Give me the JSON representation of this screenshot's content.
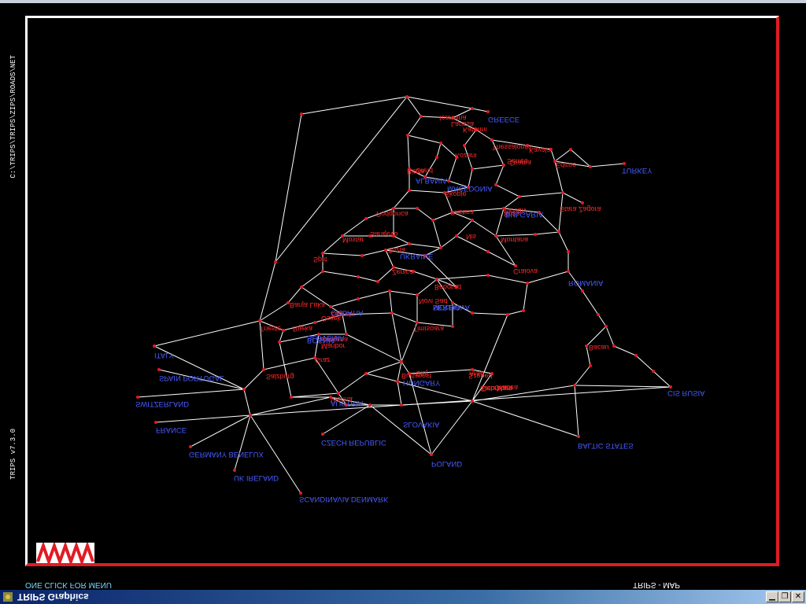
{
  "window": {
    "title": "TRIPS Graphics",
    "controls": [
      "minimize",
      "restore",
      "close"
    ]
  },
  "sidebar_text": {
    "file_path": "C:\\TRIPS\\TRIPS\\ZIPS\\ROADS\\NET",
    "version": "TRIPS v7.3.0"
  },
  "footer": {
    "menu_hint": "ONE CLICK FOR MENU",
    "app_status": "TRIPS - MAP"
  },
  "colors": {
    "background": "#000000",
    "network_links": "#ffffff",
    "nodes": "#e01b24",
    "city_labels": "#ff2a2a",
    "zone_labels": "#4a5bff"
  },
  "map": {
    "city_labels": [
      "Ioannina",
      "Larissa",
      "Katerini",
      "Thessaloniki",
      "Kavala",
      "Drama",
      "Serres",
      "Edirne",
      "Kozani",
      "Bitola",
      "Ohrid",
      "Skopje",
      "Pristina",
      "Nis",
      "Sofia",
      "Plovdiv",
      "Stara Zagora",
      "Montana",
      "Craiova",
      "Podgorica",
      "Split",
      "Mostar",
      "Sarajevo",
      "Tuzla",
      "Zenica",
      "Banja Luka",
      "Osijek",
      "Novi Sad",
      "Beograd",
      "Timisoara",
      "Arad",
      "Oradea",
      "Cluj",
      "Zagreb",
      "Rijeka",
      "Trieste",
      "Ljubljana",
      "Maribor",
      "Graz",
      "Szeged",
      "Debrecen",
      "Budapest",
      "Satu Mare",
      "Bacau",
      "Vienna",
      "Salzburg"
    ],
    "zone_labels": [
      "GREECE",
      "TURKEY",
      "BULGARIA",
      "ALBANIA",
      "MACEDONIA",
      "ROMANIA",
      "MOLDOVA",
      "UKRAINE",
      "SERBIA",
      "BOSNIA",
      "CROATIA",
      "SLOVENIA",
      "AUSTRIA",
      "HUNGARY",
      "SLOVAKIA",
      "CZECH REPUBLIC",
      "POLAND",
      "BALTIC STATES",
      "CIS RUSIA",
      "ITALY",
      "SPAIN PORTUGAL",
      "SWITZERLAND",
      "FRANCE",
      "GERMANY BENELUX",
      "UK IRELAND",
      "SCANDINAVIA DENMARK"
    ]
  }
}
